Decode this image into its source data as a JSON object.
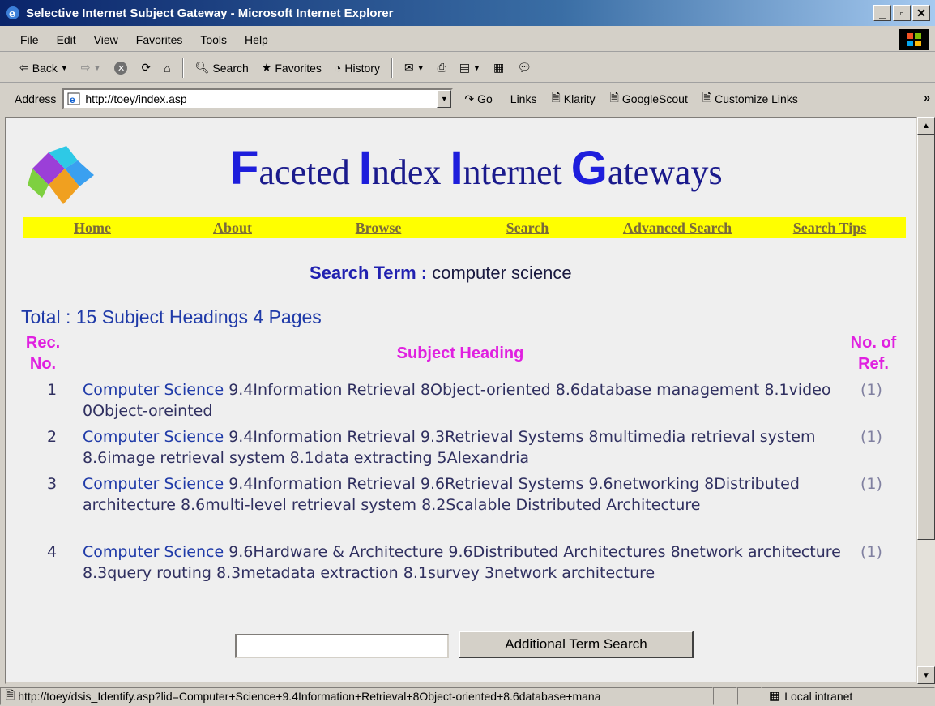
{
  "window": {
    "title": "Selective Internet Subject Gateway - Microsoft Internet Explorer"
  },
  "menu": [
    "File",
    "Edit",
    "View",
    "Favorites",
    "Tools",
    "Help"
  ],
  "toolbar": {
    "back": "Back",
    "search": "Search",
    "favorites": "Favorites",
    "history": "History"
  },
  "address": {
    "label": "Address",
    "url": "http://toey/index.asp",
    "go": "Go",
    "links_label": "Links",
    "links": [
      "Klarity",
      "GoogleScout",
      "Customize Links"
    ]
  },
  "page": {
    "banner": [
      {
        "cap": "F",
        "rest": "aceted "
      },
      {
        "cap": "I",
        "rest": "ndex "
      },
      {
        "cap": "I",
        "rest": "nternet "
      },
      {
        "cap": "G",
        "rest": "ateways"
      }
    ],
    "nav": [
      "Home",
      "About",
      "Browse",
      "Search",
      "Advanced Search",
      "Search Tips"
    ],
    "search_term_label": "Search Term :",
    "search_term_value": "computer science",
    "total": "Total : 15 Subject Headings 4 Pages",
    "headers": {
      "rec_no_1": "Rec.",
      "rec_no_2": "No.",
      "subject": "Subject Heading",
      "ref_1": "No. of",
      "ref_2": "Ref."
    },
    "rows": [
      {
        "num": "1",
        "cs": "Computer Science",
        "text": " 9.4Information Retrieval 8Object-oriented 8.6database management 8.1video 0Object-oreinted",
        "ref": "(1)"
      },
      {
        "num": "2",
        "cs": "Computer Science",
        "text": " 9.4Information Retrieval 9.3Retrieval Systems 8multimedia retrieval system 8.6image retrieval system 8.1data extracting 5Alexandria",
        "ref": "(1)"
      },
      {
        "num": "3",
        "cs": "Computer Science",
        "text": " 9.4Information Retrieval 9.6Retrieval Systems 9.6networking 8Distributed architecture 8.6multi-level retrieval system 8.2Scalable Distributed Architecture",
        "ref": "(1)"
      },
      {
        "num": "4",
        "cs": "Computer Science",
        "text": " 9.6Hardware & Architecture 9.6Distributed Architectures 8network architecture 8.3query routing 8.3metadata extraction 8.1survey 3network architecture",
        "ref": "(1)"
      }
    ],
    "term_input": "",
    "term_button": "Additional Term Search"
  },
  "status": {
    "url": "http://toey/dsis_Identify.asp?lid=Computer+Science+9.4Information+Retrieval+8Object-oriented+8.6database+mana",
    "zone": "Local intranet"
  }
}
